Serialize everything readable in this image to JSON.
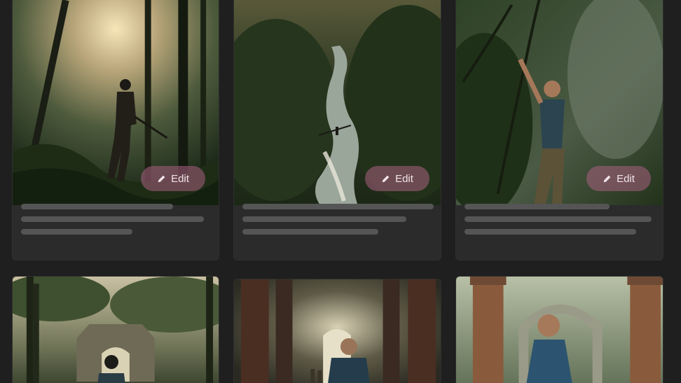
{
  "cards": [
    {
      "edit_label": "Edit"
    },
    {
      "edit_label": "Edit"
    },
    {
      "edit_label": "Edit"
    }
  ],
  "icons": {
    "edit": "pencil-icon"
  },
  "colors": {
    "background": "#1f1f1f",
    "card": "#2b2b2b",
    "edit_button": "#a86082",
    "skeleton": "#555555"
  }
}
